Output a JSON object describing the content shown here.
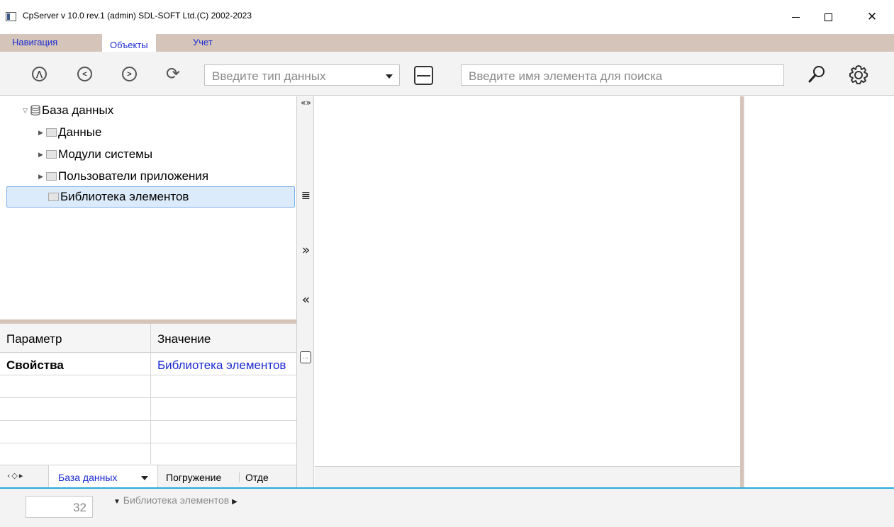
{
  "window": {
    "title": "CpServer v 10.0 rev.1 (admin) SDL-SOFT Ltd.(C) 2002-2023",
    "close_glyph": "✕"
  },
  "menu": {
    "tabs": [
      {
        "label": "Навигация",
        "active": false
      },
      {
        "label": "Объекты",
        "active": true
      },
      {
        "label": "Учет",
        "active": false
      }
    ]
  },
  "toolbar": {
    "nav_icons": [
      "up-circle-icon",
      "back-circle-icon",
      "forward-circle-icon",
      "refresh-icon"
    ],
    "nav_glyphs": [
      "⋀",
      "<",
      ">",
      "⟳"
    ],
    "type_placeholder": "Введите тип данных",
    "search_placeholder": "Введите имя элемента для поиска"
  },
  "tree": {
    "items": [
      {
        "label": "База данных",
        "level": 0,
        "icon": "database-icon",
        "expanded": true
      },
      {
        "label": "Данные",
        "level": 1,
        "icon": "folder-icon",
        "expandable": true
      },
      {
        "label": "Модули системы",
        "level": 1,
        "icon": "folder-icon",
        "expandable": true
      },
      {
        "label": "Пользователи приложения",
        "level": 1,
        "icon": "folder-icon",
        "expandable": true
      },
      {
        "label": "Библиотека элементов",
        "level": 1,
        "icon": "folder-icon",
        "selected": true
      }
    ]
  },
  "properties": {
    "headers": [
      "Параметр",
      "Значение"
    ],
    "rows": [
      {
        "name": "Свойства",
        "value": "Библиотека элементов"
      },
      {
        "name": "",
        "value": ""
      },
      {
        "name": "",
        "value": ""
      },
      {
        "name": "",
        "value": ""
      },
      {
        "name": "",
        "value": ""
      }
    ]
  },
  "bottom_tabs": {
    "nav": "‹◇▸",
    "active": "База данных",
    "tabs": [
      "Погружение",
      "Отде"
    ]
  },
  "strip": {
    "glyphs": [
      "«»",
      "≣",
      "»",
      "«",
      "…"
    ]
  },
  "statusbar": {
    "number": "32",
    "breadcrumb": "Библиотека элементов",
    "arrow_down": "▼",
    "arrow_right": "▶"
  },
  "colors": {
    "accent_blue": "#1c2bd1",
    "menu_bg": "#d4c4b9",
    "status_line": "#29a9d9",
    "selection_bg": "#dcebfb"
  }
}
